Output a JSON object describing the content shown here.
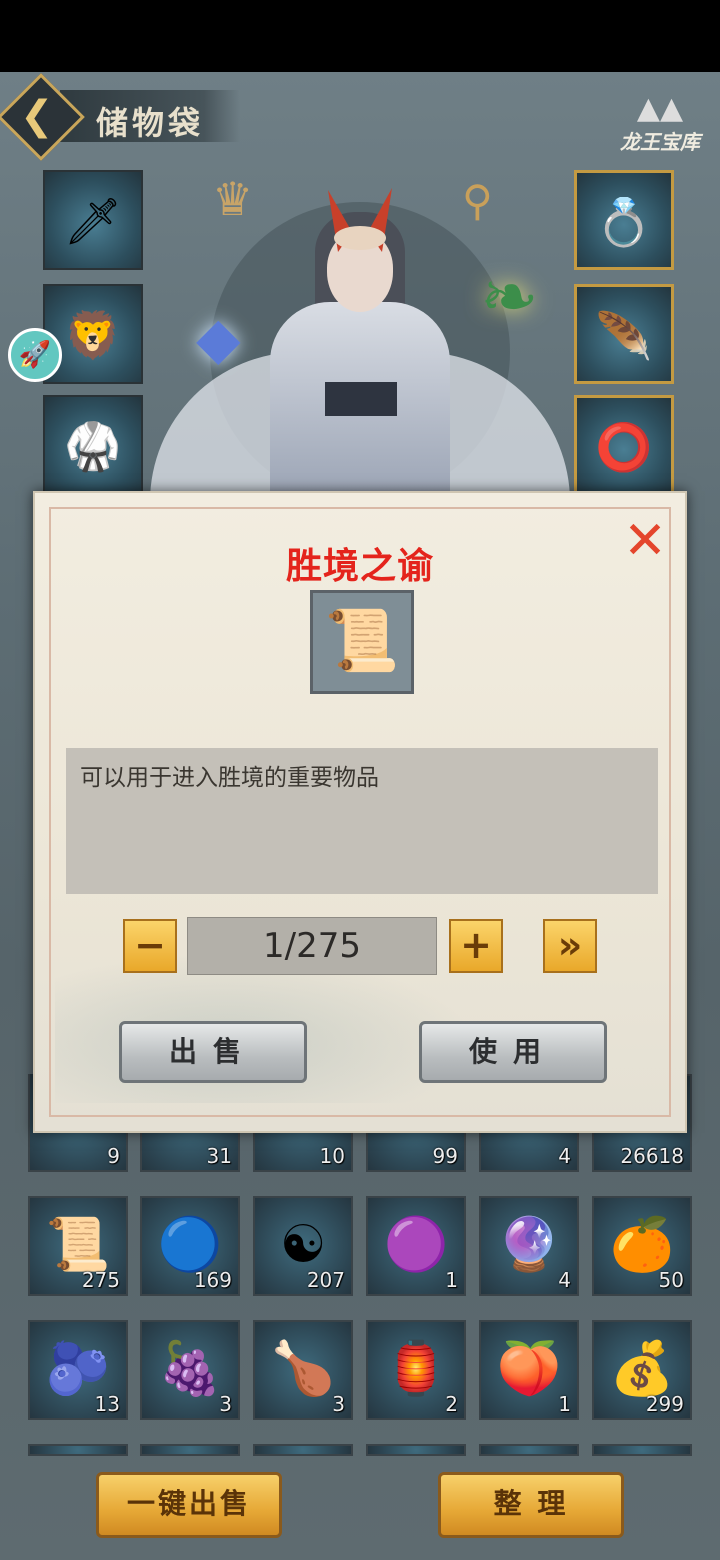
{
  "header": {
    "title": "储物袋",
    "logo_text": "龙王宝库"
  },
  "equipment": {
    "left": [
      "sword",
      "lion-helmet",
      "red-armor"
    ],
    "right": [
      "ring-eyes",
      "jade-pendant",
      "red-bracelet"
    ]
  },
  "inventory": {
    "row_partial_counts": [
      "9",
      "31",
      "10",
      "99",
      "4",
      "26618"
    ],
    "rows": [
      [
        {
          "icon": "scroll-icon",
          "g": "📜",
          "count": "275"
        },
        {
          "icon": "blue-orb-icon",
          "g": "🔵",
          "count": "169"
        },
        {
          "icon": "yin-yang-icon",
          "g": "☯",
          "count": "207"
        },
        {
          "icon": "purple-orb-icon",
          "g": "🟣",
          "count": "1"
        },
        {
          "icon": "blue-sphere-icon",
          "g": "🔮",
          "count": "4"
        },
        {
          "icon": "orange-fruit-icon",
          "g": "🍊",
          "count": "50"
        }
      ],
      [
        {
          "icon": "gourd-icon",
          "g": "🫐",
          "count": "13"
        },
        {
          "icon": "purple-fruit-icon",
          "g": "🍇",
          "count": "3"
        },
        {
          "icon": "drumstick-icon",
          "g": "🍗",
          "count": "3"
        },
        {
          "icon": "lantern-fruit-icon",
          "g": "🏮",
          "count": "2"
        },
        {
          "icon": "peach-icon",
          "g": "🍑",
          "count": "1"
        },
        {
          "icon": "money-bag-icon",
          "g": "💰",
          "count": "299"
        }
      ]
    ]
  },
  "buttons": {
    "sell_all": "一键出售",
    "sort": "整 理"
  },
  "dialog": {
    "title": "胜境之谕",
    "description": "可以用于进入胜境的重要物品",
    "quantity": "1/275",
    "minus": "−",
    "plus": "+",
    "max": "»",
    "sell": "出售",
    "use": "使用",
    "title_color": "#e4241c"
  }
}
